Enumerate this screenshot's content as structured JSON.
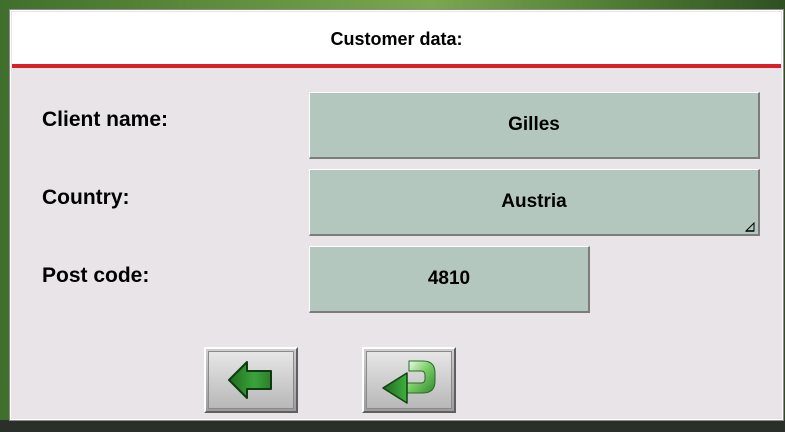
{
  "dialog": {
    "title": "Customer data:"
  },
  "form": {
    "client_name_label": "Client name:",
    "client_name_value": "Gilles",
    "country_label": "Country:",
    "country_value": "Austria",
    "post_code_label": "Post code:",
    "post_code_value": "4810"
  },
  "buttons": {
    "back_icon": "arrow-left-icon",
    "confirm_icon": "return-arrow-icon"
  },
  "colors": {
    "accent": "#d8202a",
    "field_bg": "#b4c7bf",
    "dialog_bg": "#e8e4e8",
    "icon_green": "#2f8a2f"
  }
}
